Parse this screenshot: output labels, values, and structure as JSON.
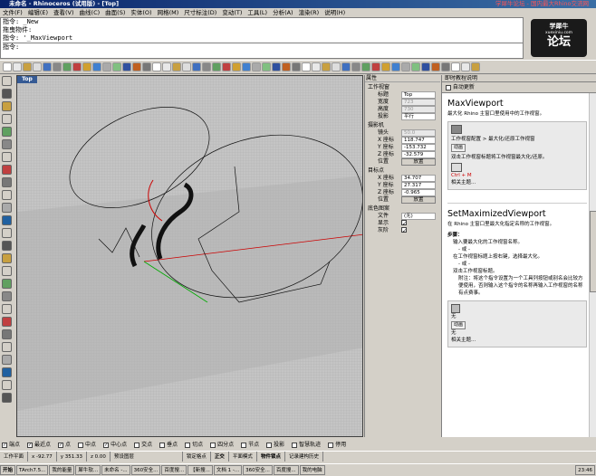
{
  "window": {
    "title": "未命名 - Rhinoceros (试用版) - [Top]",
    "watermark": "学犀牛论坛 - 国内最大Rhino交流网"
  },
  "menu": [
    "文件(F)",
    "编辑(E)",
    "查看(V)",
    "曲线(C)",
    "曲面(S)",
    "实体(O)",
    "网格(M)",
    "尺寸标注(D)",
    "变动(T)",
    "工具(L)",
    "分析(A)",
    "渲染(R)",
    "说明(H)"
  ],
  "command": {
    "lines": [
      "指令: _New",
      "拖曳物件:",
      "指令: '_MaxViewport"
    ],
    "prompt": "指令:"
  },
  "logo": {
    "cn": "学犀牛",
    "url": "xuexiniu.com",
    "big": "论坛"
  },
  "viewport": {
    "name": "Top"
  },
  "properties": {
    "header": "属性",
    "section_viewport": "工作视窗",
    "title_label": "标题",
    "title_value": "Top",
    "width_label": "宽度",
    "width_value": "723",
    "height_label": "高度",
    "height_value": "730",
    "proj_label": "投影",
    "proj_value": "平行",
    "section_camera": "摄影机",
    "lens_label": "镜头",
    "lens_value": "50.0",
    "cx_label": "X 座标",
    "cx_value": "118.747",
    "cy_label": "Y 座标",
    "cy_value": "-153.732",
    "cz_label": "Z 座标",
    "cz_value": "-32.579",
    "cpos_label": "位置",
    "cpos_btn": "放置",
    "section_target": "目标点",
    "tx_label": "X 座标",
    "tx_value": "34.707",
    "ty_label": "Y 座标",
    "ty_value": "27.317",
    "tz_label": "Z 座标",
    "tz_value": "-0.965",
    "tpos_label": "位置",
    "tpos_btn": "放置",
    "section_wallpaper": "底色图案",
    "file_label": "文件",
    "file_value": "(无)",
    "show_label": "显示",
    "gray_label": "灰阶"
  },
  "help": {
    "header": "即时教程说明",
    "auto_update": "自动更新",
    "title1": "MaxViewport",
    "desc1": "最大化 Rhino 主窗口里使用中的工作视窗。",
    "path1": "工作视窗配置 > 最大化/还原工作视窗",
    "btn_anim": "动画",
    "desc1b": "双击工作视窗标题将工作视窗最大化/还原。",
    "shortcut": "Ctrl + M",
    "related": "相关主题...",
    "title2": "SetMaximizedViewport",
    "desc2": "在 Rhino 主窗口里最大化指定名称的工作视窗。",
    "steps_label": "步骤：",
    "step1": "输入要最大化的工作视窗名称。",
    "or1": "- 或 -",
    "step2": "在工作视窗标题上按右键，选择最大化。",
    "or2": "- 或 -",
    "step3": "双击工作视窗标题。",
    "note": "附注：将这个指令设置为一个工具列按钮或别名会比较方便使用，否则输入这个指令的名称再输入工作视窗的名称有点费事。",
    "none1": "无",
    "none2": "无",
    "related2": "相关主题..."
  },
  "osnap": [
    "端点",
    "最近点",
    "点",
    "中点",
    "中心点",
    "交点",
    "垂点",
    "切点",
    "四分点",
    "节点",
    "投影",
    "智慧轨迹",
    "停用"
  ],
  "osnap_checked": [
    true,
    true,
    true,
    false,
    true,
    false,
    false,
    false,
    false,
    false,
    false,
    false,
    false
  ],
  "status": {
    "cplane": "工作平面",
    "x": "x -92.77",
    "y": "y 351.33",
    "z": "z 0.00",
    "layer": "预设图层",
    "grid": "锁定格点",
    "ortho": "正交",
    "planar": "平面模式",
    "osnap": "物件锁点",
    "history": "记录建构历史"
  },
  "taskbar": {
    "start": "开始",
    "items": [
      "TArch7.5...",
      "我的能量",
      "犀牛软...",
      "未命名 -...",
      "360安全...",
      "百度搜...",
      "【新搜...",
      "文档 1 -...",
      "360安全...",
      "百度搜...",
      "我的电脑"
    ],
    "clock": "23:46"
  }
}
